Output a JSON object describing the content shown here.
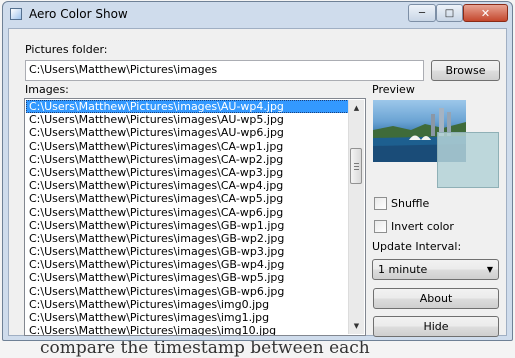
{
  "window": {
    "title": "Aero Color Show",
    "controls": {
      "minimize": "─",
      "maximize": "□",
      "close": "✕"
    }
  },
  "folder": {
    "label": "Pictures folder:",
    "value": "C:\\Users\\Matthew\\Pictures\\images",
    "browse_label": "Browse"
  },
  "images": {
    "label": "Images:",
    "selected_index": 0,
    "items": [
      "C:\\Users\\Matthew\\Pictures\\images\\AU-wp4.jpg",
      "C:\\Users\\Matthew\\Pictures\\images\\AU-wp5.jpg",
      "C:\\Users\\Matthew\\Pictures\\images\\AU-wp6.jpg",
      "C:\\Users\\Matthew\\Pictures\\images\\CA-wp1.jpg",
      "C:\\Users\\Matthew\\Pictures\\images\\CA-wp2.jpg",
      "C:\\Users\\Matthew\\Pictures\\images\\CA-wp3.jpg",
      "C:\\Users\\Matthew\\Pictures\\images\\CA-wp4.jpg",
      "C:\\Users\\Matthew\\Pictures\\images\\CA-wp5.jpg",
      "C:\\Users\\Matthew\\Pictures\\images\\CA-wp6.jpg",
      "C:\\Users\\Matthew\\Pictures\\images\\GB-wp1.jpg",
      "C:\\Users\\Matthew\\Pictures\\images\\GB-wp2.jpg",
      "C:\\Users\\Matthew\\Pictures\\images\\GB-wp3.jpg",
      "C:\\Users\\Matthew\\Pictures\\images\\GB-wp4.jpg",
      "C:\\Users\\Matthew\\Pictures\\images\\GB-wp5.jpg",
      "C:\\Users\\Matthew\\Pictures\\images\\GB-wp6.jpg",
      "C:\\Users\\Matthew\\Pictures\\images\\img0.jpg",
      "C:\\Users\\Matthew\\Pictures\\images\\img1.jpg",
      "C:\\Users\\Matthew\\Pictures\\images\\img10.jpg"
    ]
  },
  "preview": {
    "label": "Preview"
  },
  "options": {
    "shuffle_label": "Shuffle",
    "shuffle_checked": false,
    "invert_label": "Invert color",
    "invert_checked": false
  },
  "interval": {
    "label": "Update Interval:",
    "selected": "1 minute"
  },
  "buttons": {
    "about": "About",
    "hide": "Hide"
  },
  "background_text": "compare the timestamp between each",
  "icons": {
    "scroll_up": "▲",
    "scroll_down": "▼",
    "dropdown": "▼"
  },
  "colors": {
    "selection": "#3399ff",
    "window_frame": "#cfdcec",
    "close_button": "#c4472d"
  }
}
